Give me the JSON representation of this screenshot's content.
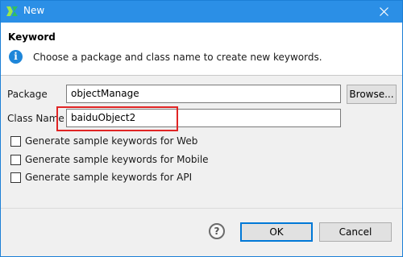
{
  "window": {
    "title": "New"
  },
  "header": {
    "title": "Keyword",
    "message": "Choose a package and class name to create new keywords."
  },
  "form": {
    "package_label": "Package",
    "package_value": "objectManage",
    "browse_label": "Browse...",
    "classname_label": "Class Name",
    "classname_value": "baiduObject2"
  },
  "options": [
    {
      "label": "Generate sample keywords for Web",
      "checked": false
    },
    {
      "label": "Generate sample keywords for Mobile",
      "checked": false
    },
    {
      "label": "Generate sample keywords for API",
      "checked": false
    }
  ],
  "footer": {
    "help_label": "?",
    "ok_label": "OK",
    "cancel_label": "Cancel"
  },
  "icons": {
    "app": "katalon-logo-icon",
    "info": "info-icon",
    "close": "close-icon",
    "help": "help-icon"
  },
  "colors": {
    "titlebar": "#2b8fe6",
    "highlight": "#e02424",
    "info": "#1e86d9"
  }
}
